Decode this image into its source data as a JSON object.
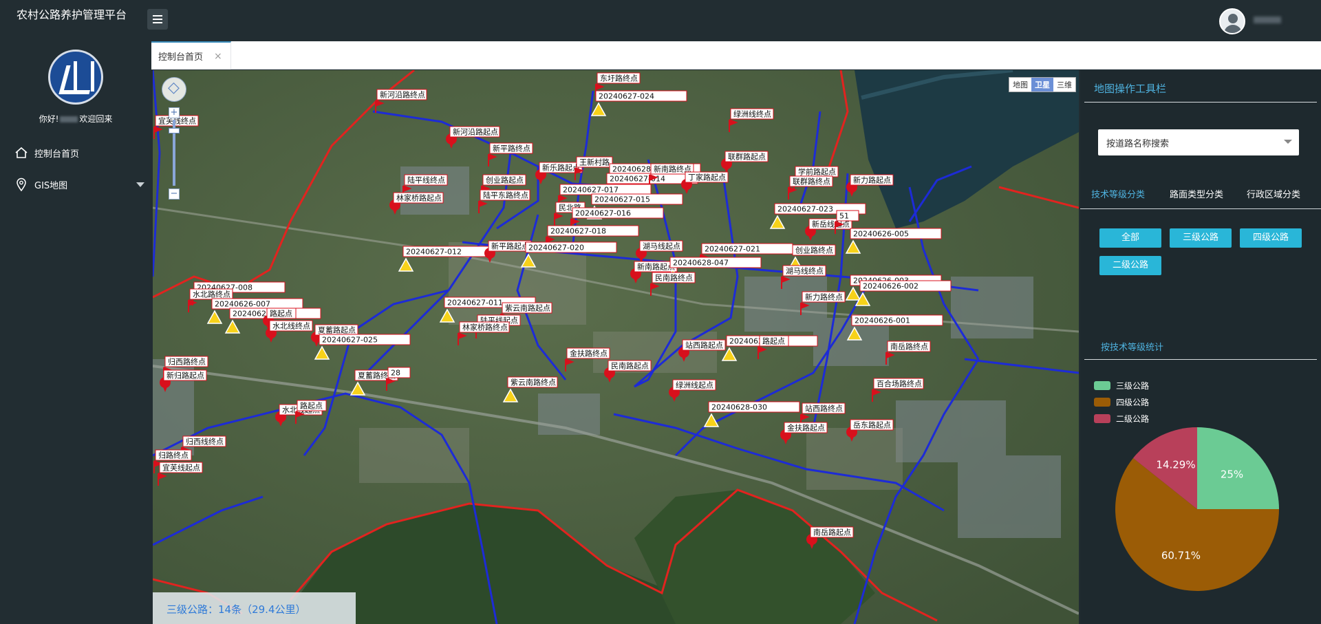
{
  "app": {
    "title": "农村公路养护管理平台"
  },
  "sidebar": {
    "welcome_prefix": "你好!",
    "welcome_suffix": "欢迎回来",
    "items": [
      {
        "label": "控制台首页",
        "icon": "home-icon"
      },
      {
        "label": "GIS地图",
        "icon": "map-pin-icon"
      }
    ]
  },
  "tabs": [
    {
      "label": "控制台首页",
      "close": "×"
    }
  ],
  "map": {
    "map_types": [
      "地图",
      "卫星",
      "三维"
    ],
    "active_map_type": "卫星",
    "zoom_in": "+",
    "zoom_out": "−",
    "status_text": "三级公路：14条（29.4公里）",
    "labels": [
      {
        "text": "东圩路终点"
      },
      {
        "text": "20240627-024"
      },
      {
        "text": "新河沿路终点"
      },
      {
        "text": "绿洲线终点"
      },
      {
        "text": "宜芙线终点"
      },
      {
        "text": "新河沿路起点"
      },
      {
        "text": "新平路终点"
      },
      {
        "text": "联群路起点"
      },
      {
        "text": "新乐路起点"
      },
      {
        "text": "王新村路"
      },
      {
        "text": "20240628-036"
      },
      {
        "text": "20240627-014"
      },
      {
        "text": "新南路终点"
      },
      {
        "text": "丁家路起点"
      },
      {
        "text": "学前路起点"
      },
      {
        "text": "联群路终点"
      },
      {
        "text": "新力路起点"
      },
      {
        "text": "陆平线终点"
      },
      {
        "text": "创业路起点"
      },
      {
        "text": "林家桥路起点"
      },
      {
        "text": "陆平东路终点"
      },
      {
        "text": "20240627-017"
      },
      {
        "text": "20240627-015"
      },
      {
        "text": "民北路"
      },
      {
        "text": "20240627-016"
      },
      {
        "text": "20240627-023"
      },
      {
        "text": "新岳线起点"
      },
      {
        "text": "20240626-005"
      },
      {
        "text": "20240627-018"
      },
      {
        "text": "20240627-012"
      },
      {
        "text": "新平路起点"
      },
      {
        "text": "20240627-020"
      },
      {
        "text": "湖马线起点"
      },
      {
        "text": "20240627-021"
      },
      {
        "text": "创业路终点"
      },
      {
        "text": "新南路起点"
      },
      {
        "text": "20240628-047"
      },
      {
        "text": "民南路终点"
      },
      {
        "text": "湖马线终点"
      },
      {
        "text": "20240626-003"
      },
      {
        "text": "20240626-002"
      },
      {
        "text": "20240627-008"
      },
      {
        "text": "水北路终点"
      },
      {
        "text": "20240626-007"
      },
      {
        "text": "20240627-011"
      },
      {
        "text": "新力路终点"
      },
      {
        "text": "20240626-006"
      },
      {
        "text": "路起点"
      },
      {
        "text": "紫云南路起点"
      },
      {
        "text": "陆平线起点"
      },
      {
        "text": "水北线终点"
      },
      {
        "text": "林家桥路终点"
      },
      {
        "text": "20240626-001"
      },
      {
        "text": "夏蓄路起点"
      },
      {
        "text": "20240627-025"
      },
      {
        "text": "站西路起点"
      },
      {
        "text": "20240627-010"
      },
      {
        "text": "路起点"
      },
      {
        "text": "南岳路终点"
      },
      {
        "text": "归西路终点"
      },
      {
        "text": "金扶路终点"
      },
      {
        "text": "民南路起点"
      },
      {
        "text": "新归路起点"
      },
      {
        "text": "夏蓄路终点"
      },
      {
        "text": "28"
      },
      {
        "text": "紫云南路终点"
      },
      {
        "text": "百合场路终点"
      },
      {
        "text": "绿洲线起点"
      },
      {
        "text": "20240628-030"
      },
      {
        "text": "水北线起点"
      },
      {
        "text": "路起点"
      },
      {
        "text": "站西路终点"
      },
      {
        "text": "岳东路起点"
      },
      {
        "text": "金扶路起点"
      },
      {
        "text": "归西线终点"
      },
      {
        "text": "归路终点"
      },
      {
        "text": "宜芙线起点"
      },
      {
        "text": "南岳路起点"
      },
      {
        "text": "51"
      }
    ]
  },
  "panel": {
    "title": "地图操作工具栏",
    "search_placeholder": "按道路名称搜索",
    "tabs": [
      "技术等级分类",
      "路面类型分类",
      "行政区域分类"
    ],
    "buttons": [
      "全部",
      "三级公路",
      "四级公路",
      "二级公路"
    ],
    "stat_title": "按技术等级统计"
  },
  "chart_data": {
    "type": "pie",
    "title": "",
    "series": [
      {
        "name": "三级公路",
        "value": 25,
        "label": "25%",
        "color": "#6bcb94"
      },
      {
        "name": "四级公路",
        "value": 60.71,
        "label": "60.71%",
        "color": "#9b5c06"
      },
      {
        "name": "二级公路",
        "value": 14.29,
        "label": "14.29%",
        "color": "#b8405a"
      }
    ],
    "legend_position": "top-left"
  },
  "colors": {
    "accent": "#29b6d8",
    "header": "#222d32",
    "road_line": "#1d2bd6",
    "boundary": "#e2231f"
  }
}
